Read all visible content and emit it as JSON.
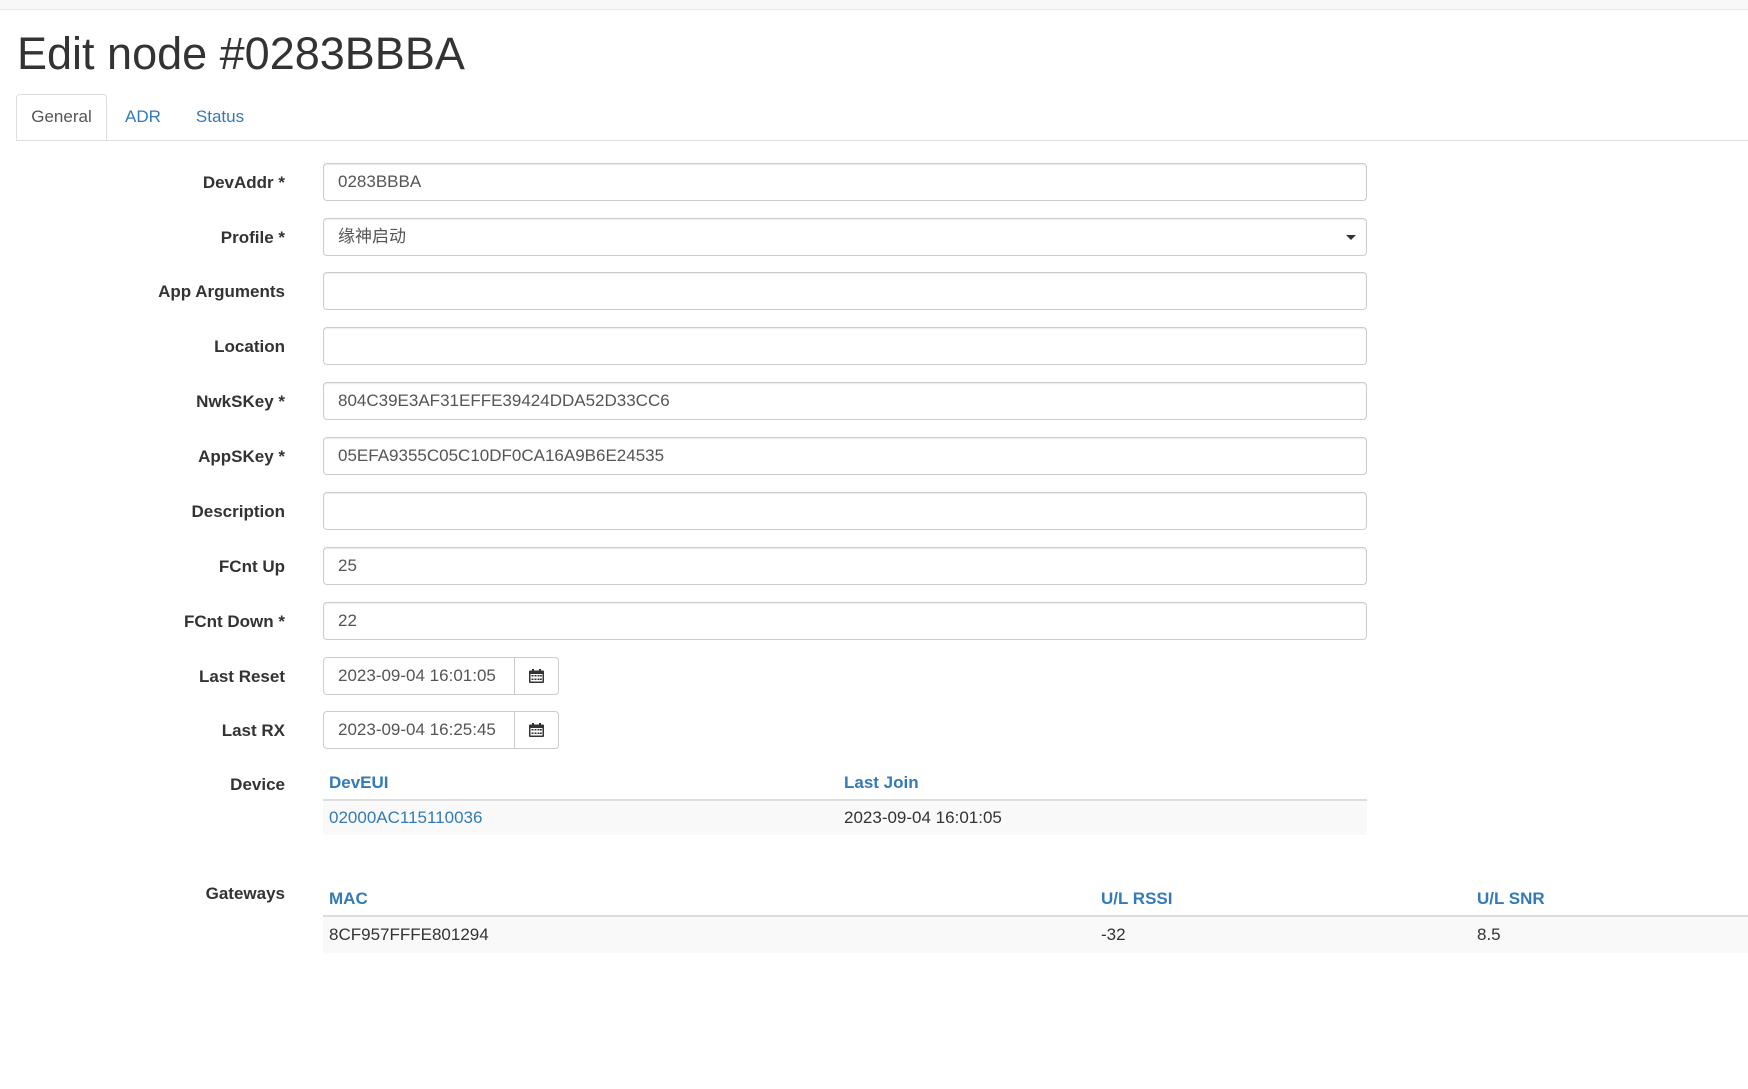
{
  "page": {
    "title": "Edit node #0283BBBA"
  },
  "tabs": [
    {
      "label": "General",
      "active": true
    },
    {
      "label": "ADR",
      "active": false
    },
    {
      "label": "Status",
      "active": false
    }
  ],
  "form": {
    "devaddr": {
      "label": "DevAddr *",
      "value": "0283BBBA"
    },
    "profile": {
      "label": "Profile *",
      "value": "缘神启动"
    },
    "app_arguments": {
      "label": "App Arguments",
      "value": ""
    },
    "location": {
      "label": "Location",
      "value": ""
    },
    "nwkskey": {
      "label": "NwkSKey *",
      "value": "804C39E3AF31EFFE39424DDA52D33CC6"
    },
    "appskey": {
      "label": "AppSKey *",
      "value": "05EFA9355C05C10DF0CA16A9B6E24535"
    },
    "description": {
      "label": "Description",
      "value": ""
    },
    "fcnt_up": {
      "label": "FCnt Up",
      "value": "25"
    },
    "fcnt_down": {
      "label": "FCnt Down *",
      "value": "22"
    },
    "last_reset": {
      "label": "Last Reset",
      "value": "2023-09-04 16:01:05"
    },
    "last_rx": {
      "label": "Last RX",
      "value": "2023-09-04 16:25:45"
    }
  },
  "device": {
    "label": "Device",
    "headers": {
      "deveui": "DevEUI",
      "last_join": "Last Join"
    },
    "rows": [
      {
        "deveui": "02000AC115110036",
        "last_join": "2023-09-04 16:01:05"
      }
    ]
  },
  "gateways": {
    "label": "Gateways",
    "headers": {
      "mac": "MAC",
      "rssi": "U/L RSSI",
      "snr": "U/L SNR"
    },
    "rows": [
      {
        "mac": "8CF957FFFE801294",
        "rssi": "-32",
        "snr": "8.5"
      }
    ]
  },
  "icons": {
    "date_picker": "calendar-icon",
    "select": "caret-down-icon"
  },
  "colors": {
    "link": "#337ab7",
    "text": "#333333",
    "border": "#cccccc"
  }
}
